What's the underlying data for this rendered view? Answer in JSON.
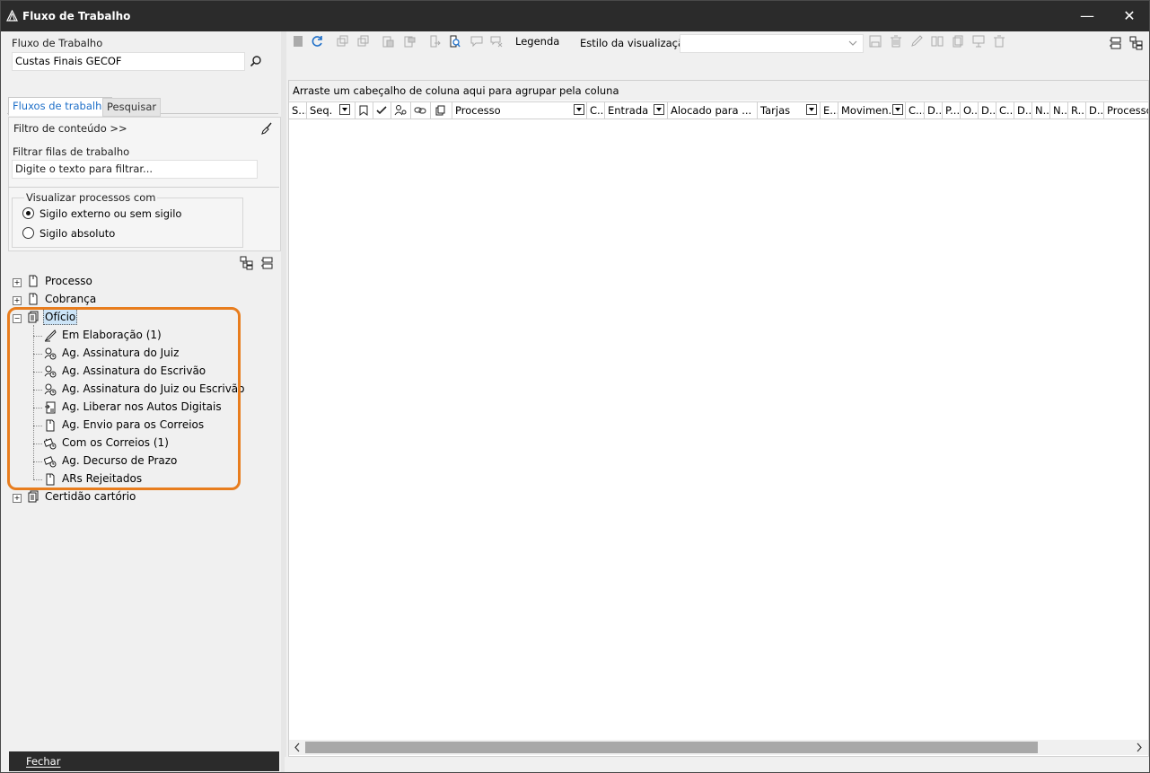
{
  "window": {
    "title": "Fluxo de Trabalho",
    "minimize_glyph": "—",
    "close_glyph": "✕"
  },
  "left": {
    "flow_label": "Fluxo de Trabalho",
    "flow_value": "Custas Finais GECOF",
    "tabs": [
      "Fluxos de trabalho",
      "Pesquisar"
    ],
    "filter_content_label": "Filtro de conteúdo >>",
    "filter_queues_label": "Filtrar filas de trabalho",
    "filter_placeholder": "Digite o texto para filtrar...",
    "visualize_group": "Visualizar processos com",
    "radio1": "Sigilo externo ou sem sigilo",
    "radio2": "Sigilo absoluto",
    "tree": {
      "processo": "Processo",
      "cobranca": "Cobrança",
      "oficio": "Ofício",
      "children": [
        "Em Elaboração (1)",
        "Ag. Assinatura do Juiz",
        "Ag. Assinatura do Escrivão",
        "Ag. Assinatura do Juiz ou Escrivão",
        "Ag. Liberar nos Autos Digitais",
        "Ag. Envio para os Correios",
        "Com os Correios (1)",
        "Ag. Decurso de Prazo",
        "ARs Rejeitados"
      ],
      "certidao": "Certidão cartório"
    },
    "close_button": "Fechar"
  },
  "toolbar": {
    "legenda": "Legenda",
    "estilo_label": "Estilo da visualização",
    "estilo_value": ""
  },
  "grid": {
    "group_hint": "Arraste um cabeçalho de coluna aqui para agrupar pela coluna",
    "columns": [
      "S...",
      "Seq.",
      "Processo",
      "C...",
      "Entrada",
      "Alocado para ...",
      "Tarjas",
      "E...",
      "Movimen...",
      "C...",
      "D...",
      "P...",
      "O...",
      "D...",
      "C...",
      "D...",
      "N...",
      "N...",
      "R...",
      "D...",
      "Processo"
    ]
  },
  "colors": {
    "titlebar": "#2b2b2b",
    "accent_blue": "#1e6fc8",
    "highlight_orange": "#e87d1e",
    "selection": "#cce4f7"
  }
}
